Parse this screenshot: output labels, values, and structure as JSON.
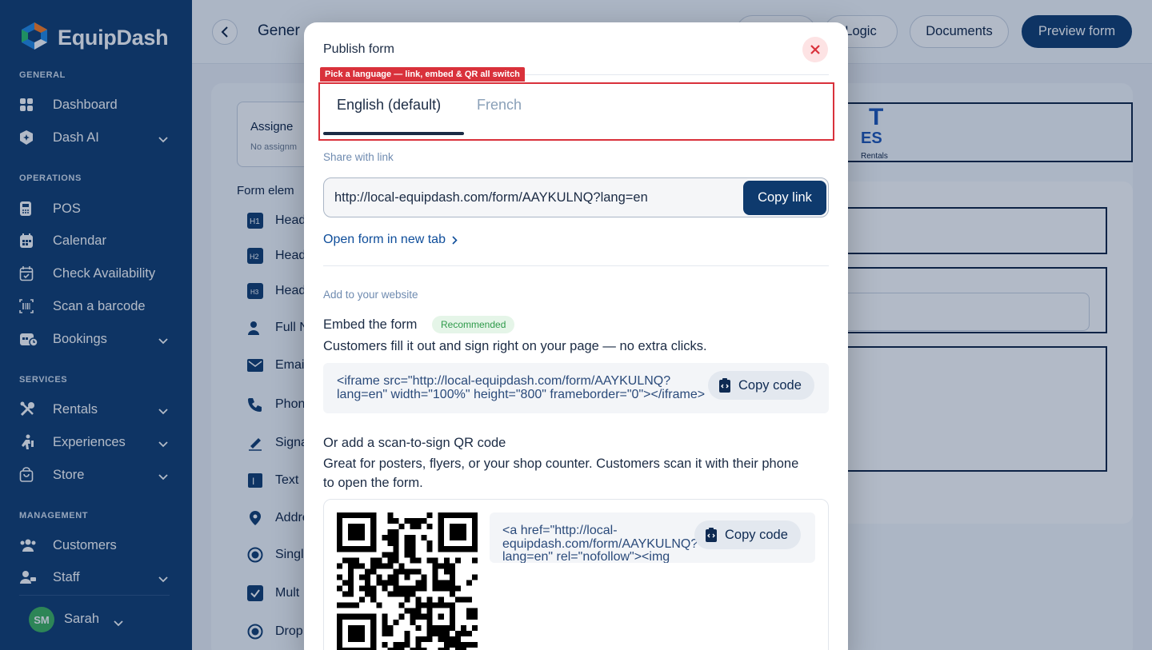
{
  "sidebar": {
    "brand": "EquipDash",
    "sections": {
      "general": "GENERAL",
      "operations": "OPERATIONS",
      "services": "SERVICES",
      "management": "MANAGEMENT"
    },
    "items": {
      "dashboard": "Dashboard",
      "dash_ai": "Dash AI",
      "pos": "POS",
      "calendar": "Calendar",
      "check_availability": "Check Availability",
      "scan_barcode": "Scan a barcode",
      "bookings": "Bookings",
      "rentals": "Rentals",
      "experiences": "Experiences",
      "store": "Store",
      "customers": "Customers",
      "staff": "Staff"
    },
    "user": {
      "initials": "SM",
      "name": "Sarah"
    }
  },
  "background": {
    "page_title": "Gener",
    "tabs": {
      "logic": "Logic",
      "documents": "Documents",
      "preview": "Preview form"
    },
    "assigned": {
      "title": "Assigne",
      "subtitle": "No assignm"
    },
    "form_elements_title": "Form elem",
    "elements": [
      "Head",
      "Head",
      "Head",
      "Full N",
      "Emai",
      "Phon",
      "Signa",
      "Text",
      "Addre",
      "Singl",
      "Mult",
      "Drop"
    ],
    "logo": {
      "big": "T",
      "mid": "ES",
      "sub": "Rentals"
    }
  },
  "modal": {
    "title": "Publish form",
    "hint": "Pick a language — link, embed & QR all switch",
    "tabs": {
      "active": "English (default)",
      "inactive": "French"
    },
    "share_label": "Share with link",
    "link_url": "http://local-equipdash.com/form/AAYKULNQ?lang=en",
    "copy_link": "Copy link",
    "open_new_tab": "Open form in new tab",
    "website_label": "Add to your website",
    "embed_heading": "Embed the form",
    "embed_badge": "Recommended",
    "embed_desc": "Customers fill it out and sign right on your page — no extra clicks.",
    "embed_code": "<iframe src=\"http://local-equipdash.com/form/AAYKULNQ?lang=en\" width=\"100%\" height=\"800\" frameborder=\"0\"></iframe>",
    "copy_code": "Copy code",
    "qr_heading": "Or add a scan-to-sign QR code",
    "qr_desc": "Great for posters, flyers, or your shop counter. Customers scan it with their phone to open the form.",
    "qr_code": "<a href=\"http://local-equipdash.com/form/AAYKULNQ?lang=en\" rel=\"nofollow\"><img",
    "copy_code_2": "Copy code"
  },
  "colors": {
    "sidebar": "#0e3a6d",
    "accent": "#0e3a6d",
    "hint_red": "#d9313b",
    "badge_green": "#2e9a4a"
  }
}
